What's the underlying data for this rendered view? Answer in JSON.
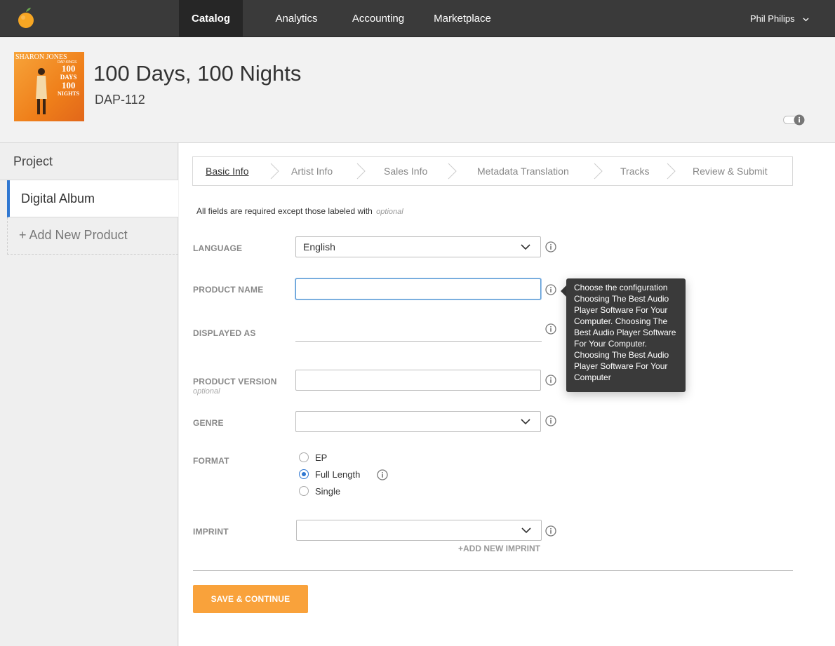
{
  "nav": {
    "items": [
      "Catalog",
      "Analytics",
      "Accounting",
      "Marketplace"
    ],
    "active": "Catalog",
    "user": "Phil Philips",
    "logo_icon": "orange-logo-icon"
  },
  "header": {
    "album_title": "100 Days, 100 Nights",
    "album_code": "DAP-112",
    "cover_art": {
      "artist_text": "SHARON JONES",
      "band_text": "DAP-KINGS",
      "title_line1": "100",
      "title_line2": "DAYS",
      "title_line3": "100",
      "title_line4": "NIGHTS"
    }
  },
  "sidebar": {
    "section": "Project",
    "active_item": "Digital Album",
    "add_item": "+ Add New Product"
  },
  "steps": [
    "Basic Info",
    "Artist Info",
    "Sales Info",
    "Metadata Translation",
    "Tracks",
    "Review & Submit"
  ],
  "form": {
    "required_note": "All fields are required except those labeled with",
    "optional_word": "optional",
    "language_label": "LANGUAGE",
    "language_value": "English",
    "product_name_label": "PRODUCT NAME",
    "product_name_value": "",
    "displayed_as_label": "DISPLAYED AS",
    "product_version_label": "PRODUCT VERSION",
    "product_version_optional": "optional",
    "genre_label": "GENRE",
    "genre_value": "",
    "format_label": "FORMAT",
    "format_options": [
      "EP",
      "Full Length",
      "Single"
    ],
    "format_selected": "Full Length",
    "imprint_label": "IMPRINT",
    "imprint_value": "",
    "add_imprint": "+ADD NEW IMPRINT",
    "save_button": "SAVE & CONTINUE"
  },
  "tooltip": {
    "text": "Choose the configuration Choosing The Best Audio Player Software For Your Computer. Choosing The Best Audio Player Software For Your Computer. Choosing The Best Audio Player Software For Your Computer"
  },
  "colors": {
    "nav_bg": "#3a3a3a",
    "accent_blue": "#2f77d1",
    "button_orange": "#f9a23b",
    "tooltip_bg": "#3a3a3a"
  }
}
